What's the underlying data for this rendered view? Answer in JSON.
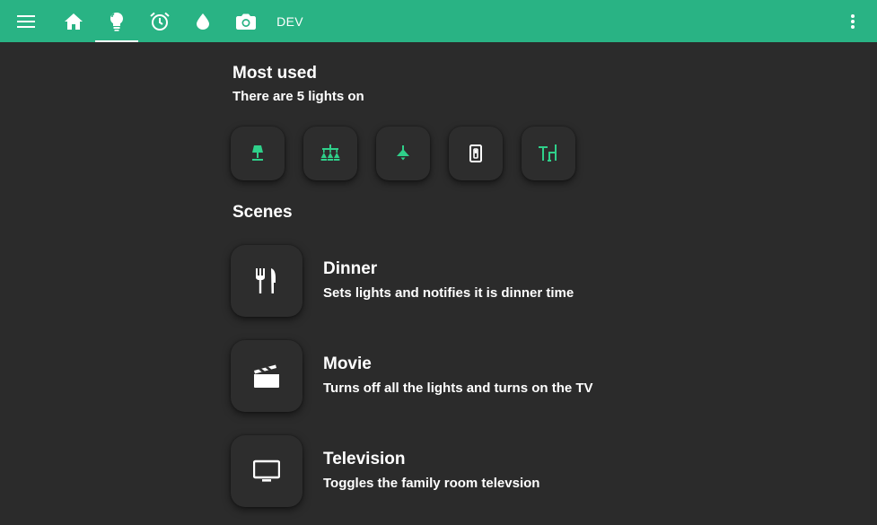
{
  "colors": {
    "accent": "#29b384",
    "background": "#2b2b2b",
    "card": "#2d2d2d",
    "icon_on": "#2fd08a",
    "text": "#ffffff"
  },
  "topbar": {
    "menu_icon": "menu-icon",
    "tabs": [
      {
        "icon": "home-icon",
        "active": false
      },
      {
        "icon": "lightbulb-icon",
        "active": true
      },
      {
        "icon": "alarm-clock-icon",
        "active": false
      },
      {
        "icon": "water-drop-icon",
        "active": false
      },
      {
        "icon": "camera-icon",
        "active": false
      }
    ],
    "dev_label": "DEV",
    "more_icon": "more-vert-icon"
  },
  "most_used": {
    "title": "Most used",
    "subtitle": "There are 5 lights on",
    "lights": [
      {
        "icon": "table-lamp-icon",
        "state": "on"
      },
      {
        "icon": "chandelier-icon",
        "state": "on"
      },
      {
        "icon": "ceiling-light-icon",
        "state": "on"
      },
      {
        "icon": "light-switch-icon",
        "state": "off"
      },
      {
        "icon": "desk-lamp-icon",
        "state": "on"
      }
    ]
  },
  "scenes": {
    "title": "Scenes",
    "items": [
      {
        "icon": "silverware-icon",
        "title": "Dinner",
        "description": "Sets lights and notifies it is dinner time"
      },
      {
        "icon": "movie-clapper-icon",
        "title": "Movie",
        "description": "Turns off all the lights and turns on the TV"
      },
      {
        "icon": "television-icon",
        "title": "Television",
        "description": "Toggles the family room televsion"
      }
    ]
  }
}
